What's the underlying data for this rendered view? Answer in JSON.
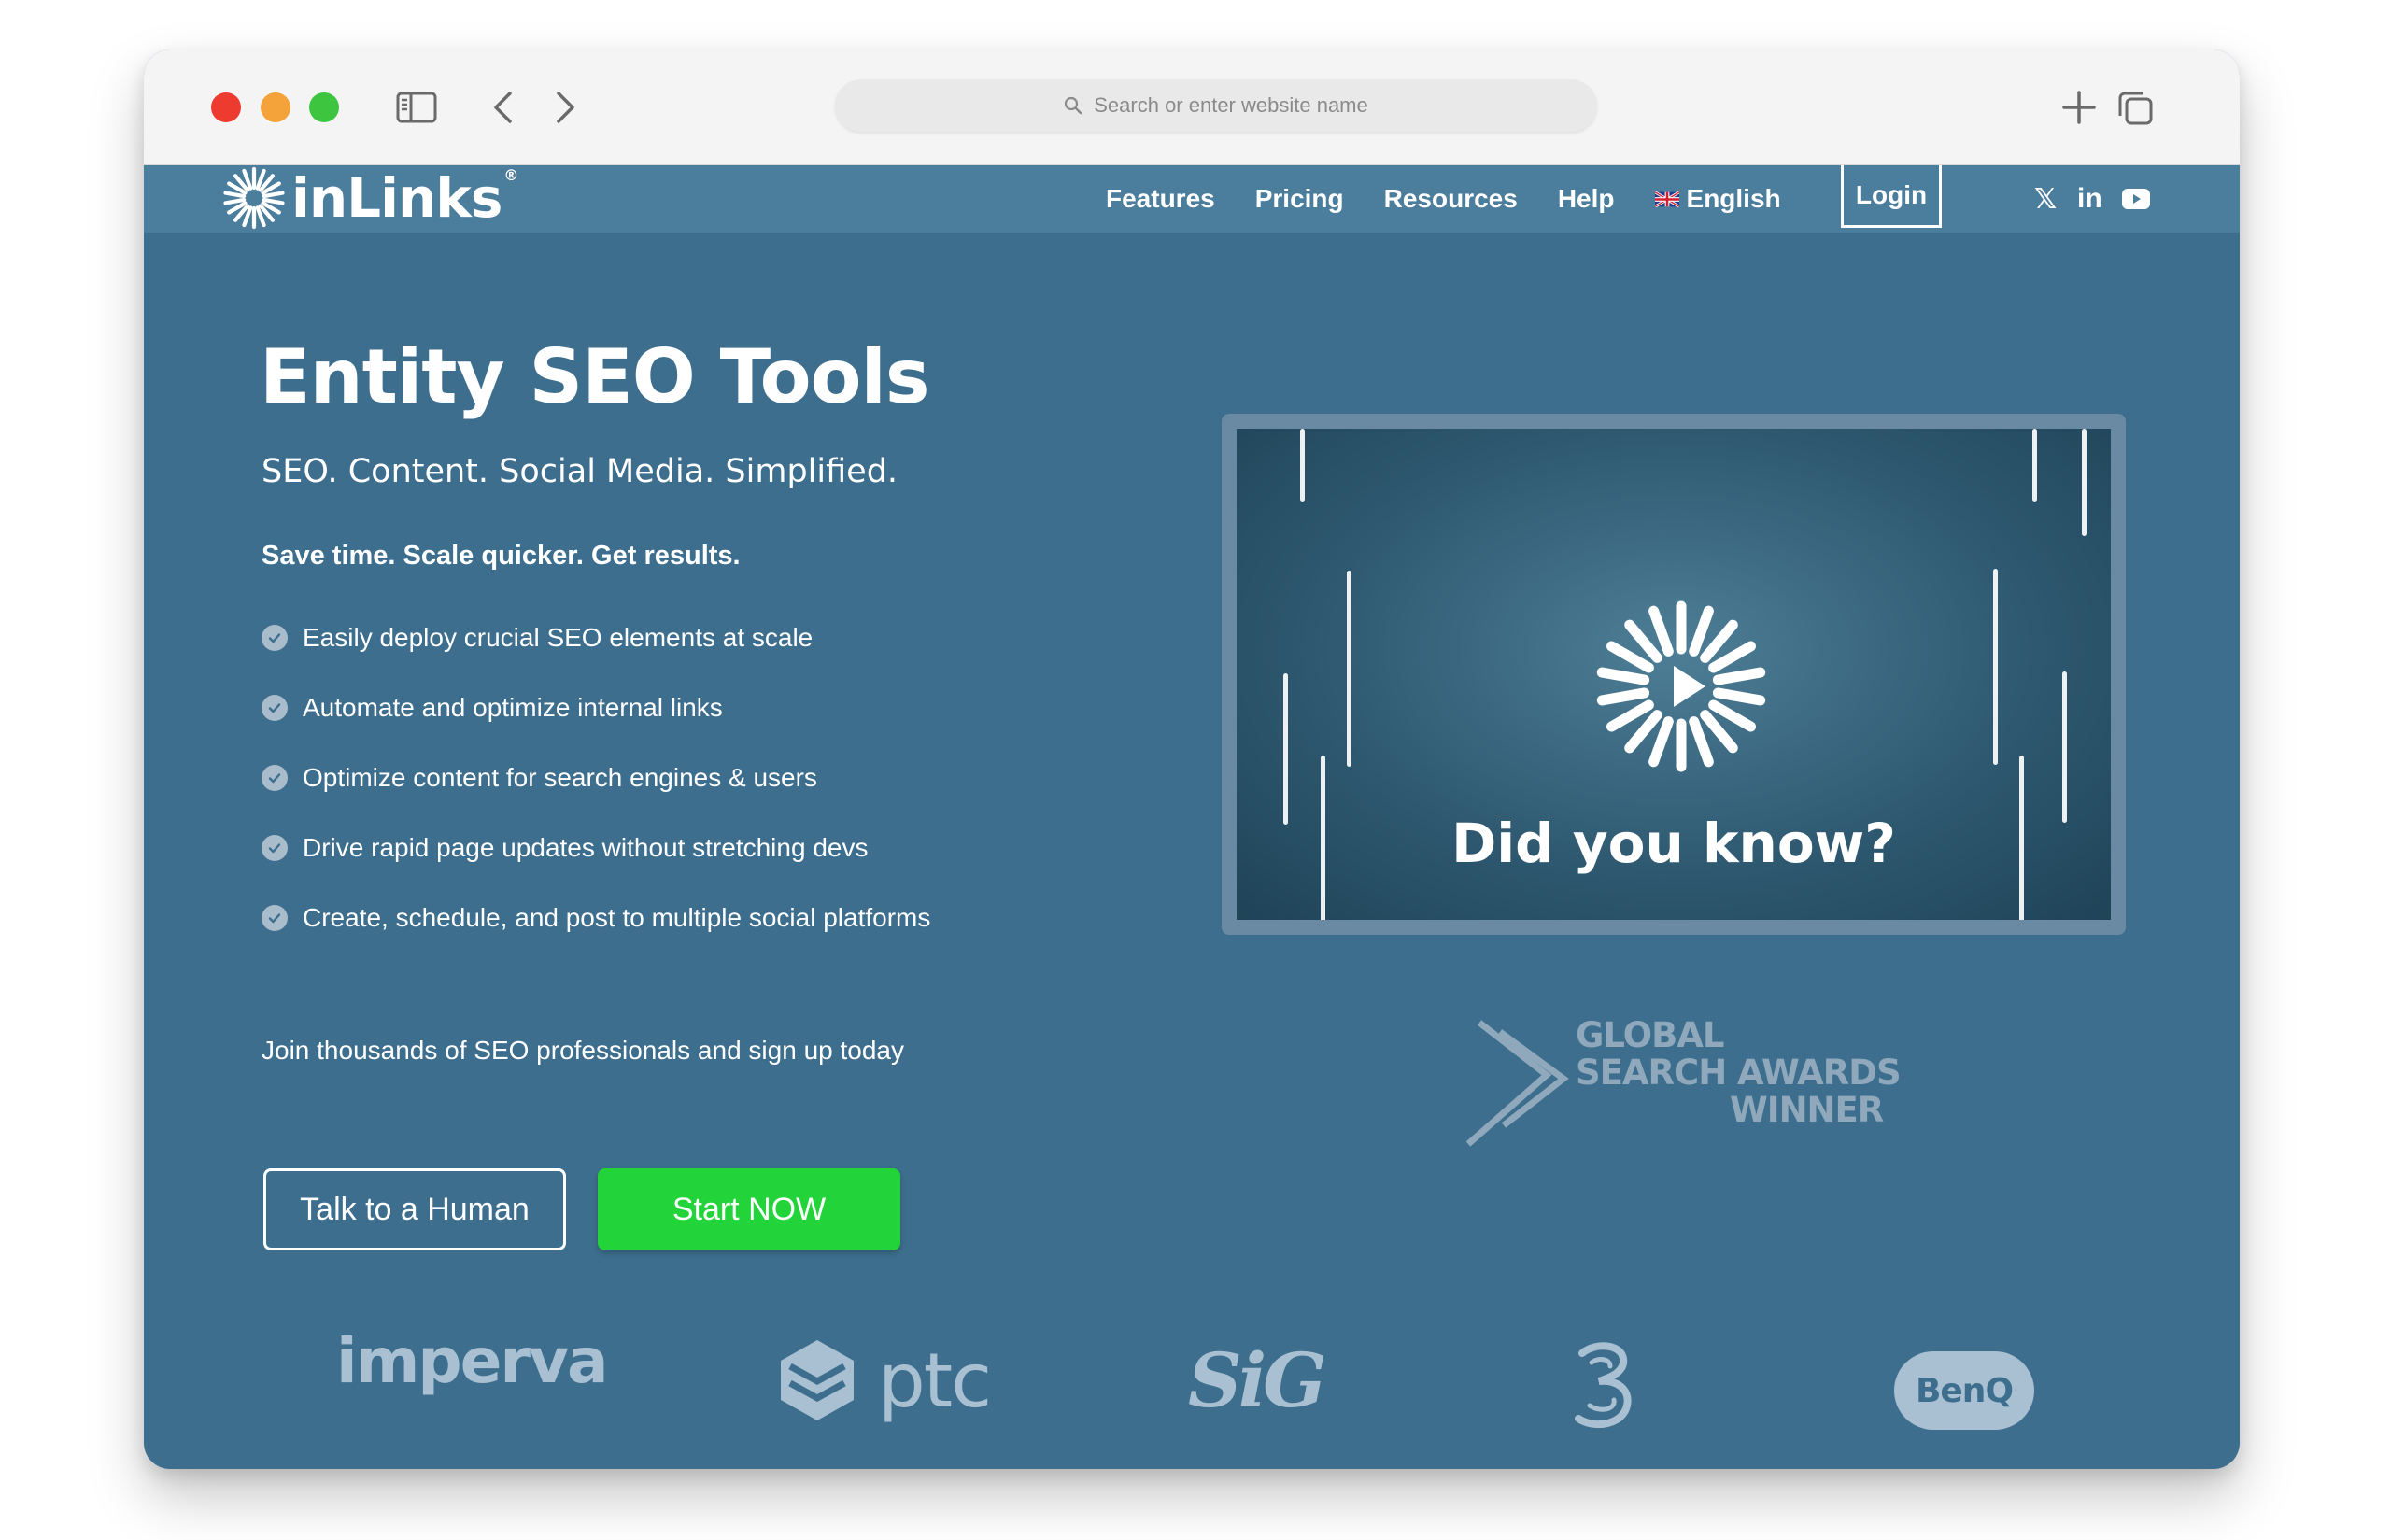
{
  "browser": {
    "url_placeholder": "Search or enter website name",
    "icons": [
      "sidebar-icon",
      "back-arrow-icon",
      "forward-arrow-icon",
      "new-tab-plus-icon",
      "tabs-overview-icon",
      "search-icon"
    ]
  },
  "nav": {
    "logo_text": "inLinks",
    "logo_mark": "®",
    "links": [
      {
        "label": "Features"
      },
      {
        "label": "Pricing"
      },
      {
        "label": "Resources"
      },
      {
        "label": "Help"
      }
    ],
    "language": "English",
    "login": "Login",
    "social": {
      "x": "𝕏",
      "linkedin": "in"
    }
  },
  "hero": {
    "title": "Entity SEO Tools",
    "subtitle": "SEO. Content. Social Media. Simplified.",
    "tagline": "Save time. Scale quicker. Get results.",
    "features": [
      "Easily deploy crucial SEO elements at scale",
      "Automate and optimize internal links",
      "Optimize content for search engines & users",
      "Drive rapid page updates without stretching devs",
      "Create, schedule, and post to multiple social platforms"
    ],
    "join_text": "Join thousands of SEO professionals and sign up today",
    "cta_secondary": "Talk to a Human",
    "cta_primary": "Start NOW"
  },
  "video": {
    "caption": "Did you know?"
  },
  "award": {
    "line1": "GLOBAL",
    "line2": "SEARCH AWARDS",
    "line3": "WINNER"
  },
  "clients": {
    "imperva": "imperva",
    "ptc": "ptc",
    "sig": "SiG",
    "benq": "BenQ"
  },
  "colors": {
    "page_bg": "#3d6e8d",
    "nav_bg": "#4b7d9c",
    "cta_green": "#22d43a",
    "logo_muted": "#a9c0d2"
  }
}
